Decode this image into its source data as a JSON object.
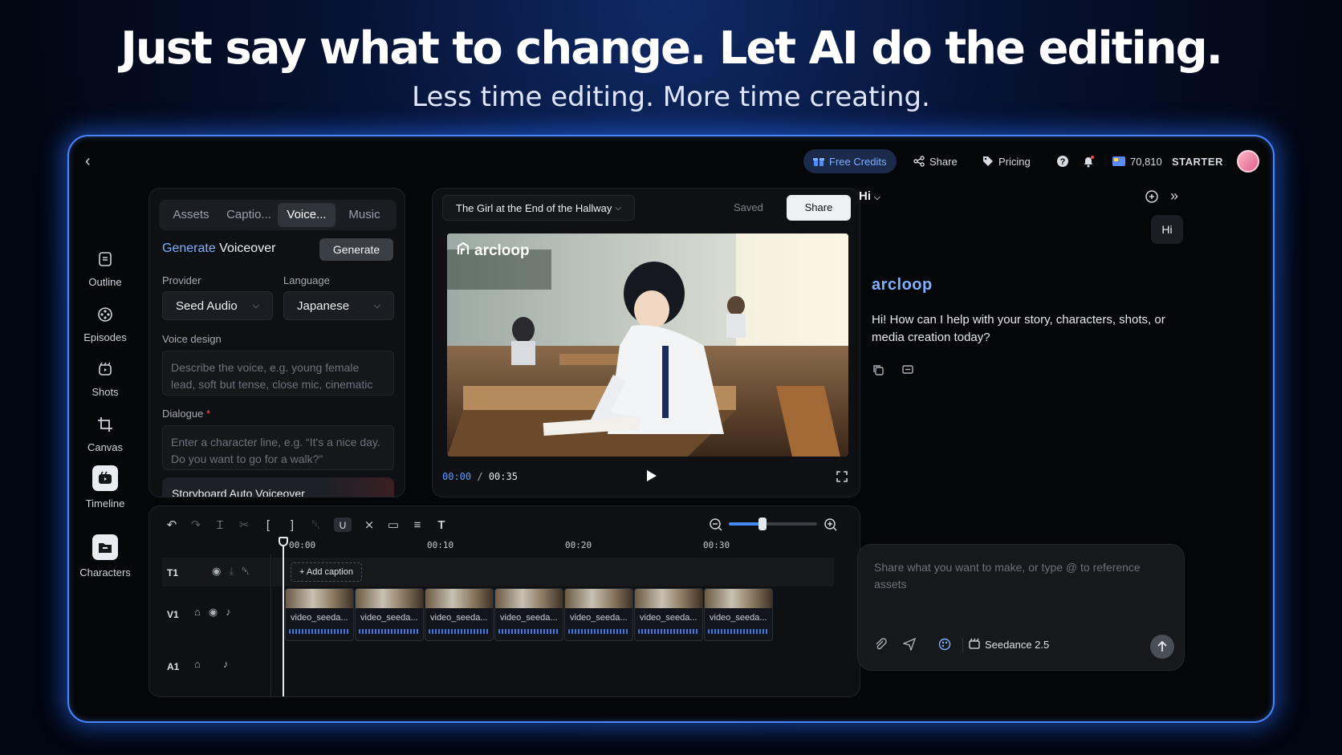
{
  "hero": {
    "title": "Just say what to change. Let AI do the editing.",
    "subtitle": "Less time editing. More time creating."
  },
  "topbar": {
    "free_credits": "Free Credits",
    "share": "Share",
    "pricing": "Pricing",
    "credits": "70,810",
    "plan": "STARTER"
  },
  "leftnav": {
    "items": [
      {
        "label": "Outline"
      },
      {
        "label": "Episodes"
      },
      {
        "label": "Shots"
      },
      {
        "label": "Canvas"
      },
      {
        "label": "Timeline"
      },
      {
        "label": "Characters"
      }
    ]
  },
  "assets_panel": {
    "tabs": [
      "Assets",
      "Captio...",
      "Voice...",
      "Music"
    ],
    "heading_accent": "Generate",
    "heading_rest": " Voiceover",
    "generate_label": "Generate",
    "provider_label": "Provider",
    "provider_value": "Seed Audio",
    "language_label": "Language",
    "language_value": "Japanese",
    "voice_design_label": "Voice design",
    "voice_design_placeholder": "Describe the voice, e.g. young female lead, soft but tense, close mic, cinematic",
    "dialogue_label": "Dialogue",
    "dialogue_required": "*",
    "dialogue_placeholder": "Enter a character line, e.g. “It's a nice day. Do you want to go for a walk?”",
    "storyboard_label": "Storyboard Auto Voiceover"
  },
  "preview": {
    "project_title": "The Girl at the End of the Hallway",
    "saved": "Saved",
    "share": "Share",
    "watermark": "arcloop",
    "time_current": "00:00",
    "time_sep": "/",
    "time_total": "00:35"
  },
  "timeline": {
    "ruler": [
      "00:00",
      "00:10",
      "00:20",
      "00:30"
    ],
    "zoom_fraction": 0.38,
    "tracks": {
      "t1": "T1",
      "v1": "V1",
      "a1": "A1"
    },
    "add_caption": "+ Add caption",
    "clips": [
      "video_seeda...",
      "video_seeda...",
      "video_seeda...",
      "video_seeda...",
      "video_seeda...",
      "video_seeda...",
      "video_seeda..."
    ]
  },
  "chat": {
    "title": "Hi",
    "user_message": "Hi",
    "brand": "arcloop",
    "assistant_message": "Hi! How can I help with your story, characters, shots, or media creation today?",
    "input_placeholder": "Share what you want to make, or type @ to reference assets",
    "model": "Seedance 2.5"
  },
  "colors": {
    "accent": "#4b86ff",
    "link": "#7fb0ff",
    "brand": "#7fb0ff"
  }
}
